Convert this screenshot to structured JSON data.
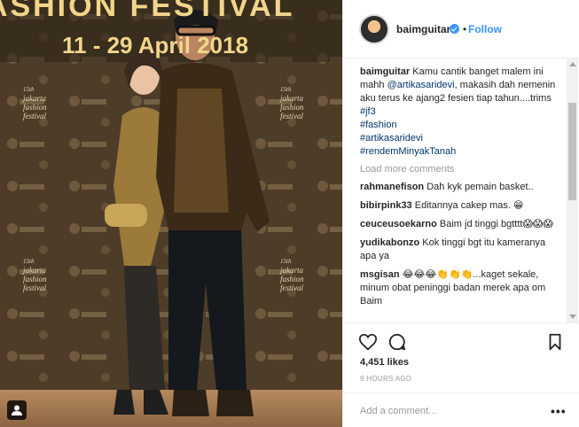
{
  "photo": {
    "banner_text": "FASHION FESTIVAL",
    "banner_dates": "11 - 29 April 2018",
    "backdrop_logo": "jakarta fashion festival",
    "backdrop_num": "15th"
  },
  "header": {
    "username": "baimguitar",
    "separator": "•",
    "follow_label": "Follow"
  },
  "caption": {
    "username": "baimguitar",
    "text_1": "Kamu cantik banget malem ini mahh",
    "mention": "@artikasaridevi",
    "text_2": ", makasih dah nemenin aku terus ke ajang2 fesien tiap tahun....trims",
    "tags": [
      "#jf3",
      "#fashion",
      "#artikasaridevi",
      "#rendemMinyakTanah"
    ]
  },
  "load_more": "Load more comments",
  "comments": [
    {
      "user": "rahmanefison",
      "text": "Dah kyk pemain basket.."
    },
    {
      "user": "bibirpink33",
      "text": "Editannya cakep mas. 😁"
    },
    {
      "user": "ceuceusoekarno",
      "text": "Baim jd tinggi bgtttt😱😱😱"
    },
    {
      "user": "yudikabonzo",
      "text": "Kok tinggi bgt itu kameranya apa ya"
    },
    {
      "user": "msgisan",
      "text": "😂😂😂👏👏👏...kaget sekale, minum obat peninggi badan merek apa om Baim"
    }
  ],
  "likes": "4,451 likes",
  "time": "9 HOURS AGO",
  "add_comment_placeholder": "Add a comment...",
  "more_label": "•••",
  "colors": {
    "link": "#3897f0",
    "mention": "#003569",
    "muted": "#999999",
    "text": "#262626"
  },
  "icons": [
    "heart-icon",
    "comment-icon",
    "bookmark-icon",
    "tagged-user-icon",
    "verified-badge-icon",
    "more-options-icon"
  ]
}
